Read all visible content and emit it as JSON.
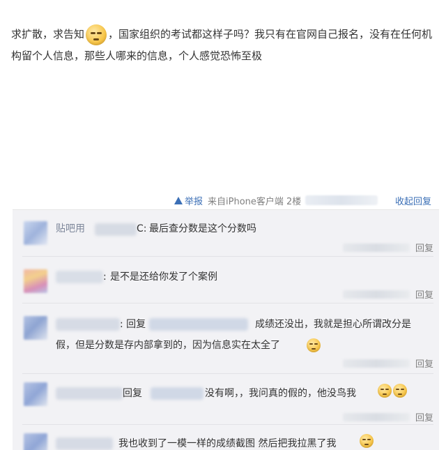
{
  "post": {
    "text_part1": "求扩散，求告知",
    "emoji_main": "thinking-emoji",
    "text_part2": "，国家组织的考试都这样子吗？我只有在官网自己报名，没有在任何机构留个人信息，那些人哪来的信息，个人感觉恐怖至极"
  },
  "actions": {
    "report_label": "举报",
    "source_label": "来自iPhone客户端",
    "floor_label": "2楼",
    "collapse_label": "收起回复"
  },
  "comments": [
    {
      "name_fragment": "贴吧用",
      "name_suffix": "C:",
      "text": "最后查分数是这个分数吗",
      "reply_label": "回复"
    },
    {
      "name_suffix": ":",
      "text": "是不是还给你发了个案例",
      "reply_label": "回复"
    },
    {
      "prefix": ": 回复",
      "text_line1": "成绩还没出，我就是担心所谓改分是",
      "text_line2": "假，但是分数是存内部拿到的，因为信息实在太全了",
      "reply_label": "回复"
    },
    {
      "prefix": "回复",
      "text": "没有啊，，我问真的假的，他没鸟我",
      "reply_label": "回复"
    },
    {
      "text": "我也收到了一模一样的成绩截图 然后把我拉黑了我"
    }
  ],
  "colors": {
    "link": "#3b6fb6",
    "muted": "#808080",
    "panel": "#f2f2f5"
  }
}
